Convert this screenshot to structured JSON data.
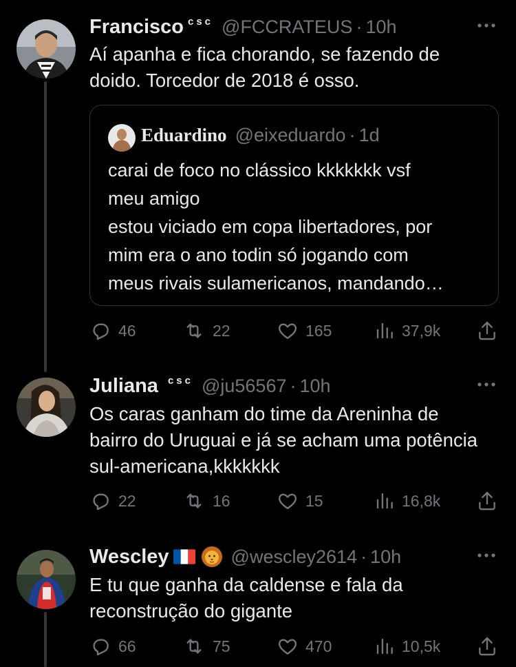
{
  "colors": {
    "background": "#000000",
    "text": "#e7e9ea",
    "muted": "#71767b",
    "border": "#2f3336"
  },
  "tweets": [
    {
      "name": "Francisco",
      "superscript": "csc",
      "handle": "@FCCRATEUS",
      "separator": "·",
      "time": "10h",
      "text": "Aí apanha e fica chorando, se fazendo de doido. Torcedor de 2018 é osso.",
      "avatar_icon": "user-avatar-photo",
      "quote": {
        "name": "Eduardino",
        "handle": "@eixeduardo",
        "separator": "·",
        "time": "1d",
        "lines": [
          "carai de foco no clássico kkkkkkk vsf",
          "meu amigo",
          "estou viciado em copa libertadores, por",
          "mim era o ano todin só jogando com",
          "meus rivais sulamericanos, mandando…"
        ]
      },
      "stats": {
        "replies": "46",
        "retweets": "22",
        "likes": "165",
        "views": "37,9k"
      }
    },
    {
      "name": "Juliana",
      "superscript": "csc",
      "handle": "@ju56567",
      "separator": "·",
      "time": "10h",
      "text": "Os caras ganham do time da Areninha de bairro do Uruguai e já se acham uma potência sul-americana,kkkkkkk",
      "avatar_icon": "user-avatar-photo",
      "stats": {
        "replies": "22",
        "retweets": "16",
        "likes": "15",
        "views": "16,8k"
      }
    },
    {
      "name": "Wescley",
      "name_emojis": [
        "france-flag-icon",
        "lion-face-icon"
      ],
      "handle": "@wescley2614",
      "separator": "·",
      "time": "10h",
      "text": "E tu que ganha da caldense e fala da reconstrução do gigante",
      "avatar_icon": "user-avatar-photo",
      "stats": {
        "replies": "66",
        "retweets": "75",
        "likes": "470",
        "views": "10,5k"
      }
    }
  ]
}
